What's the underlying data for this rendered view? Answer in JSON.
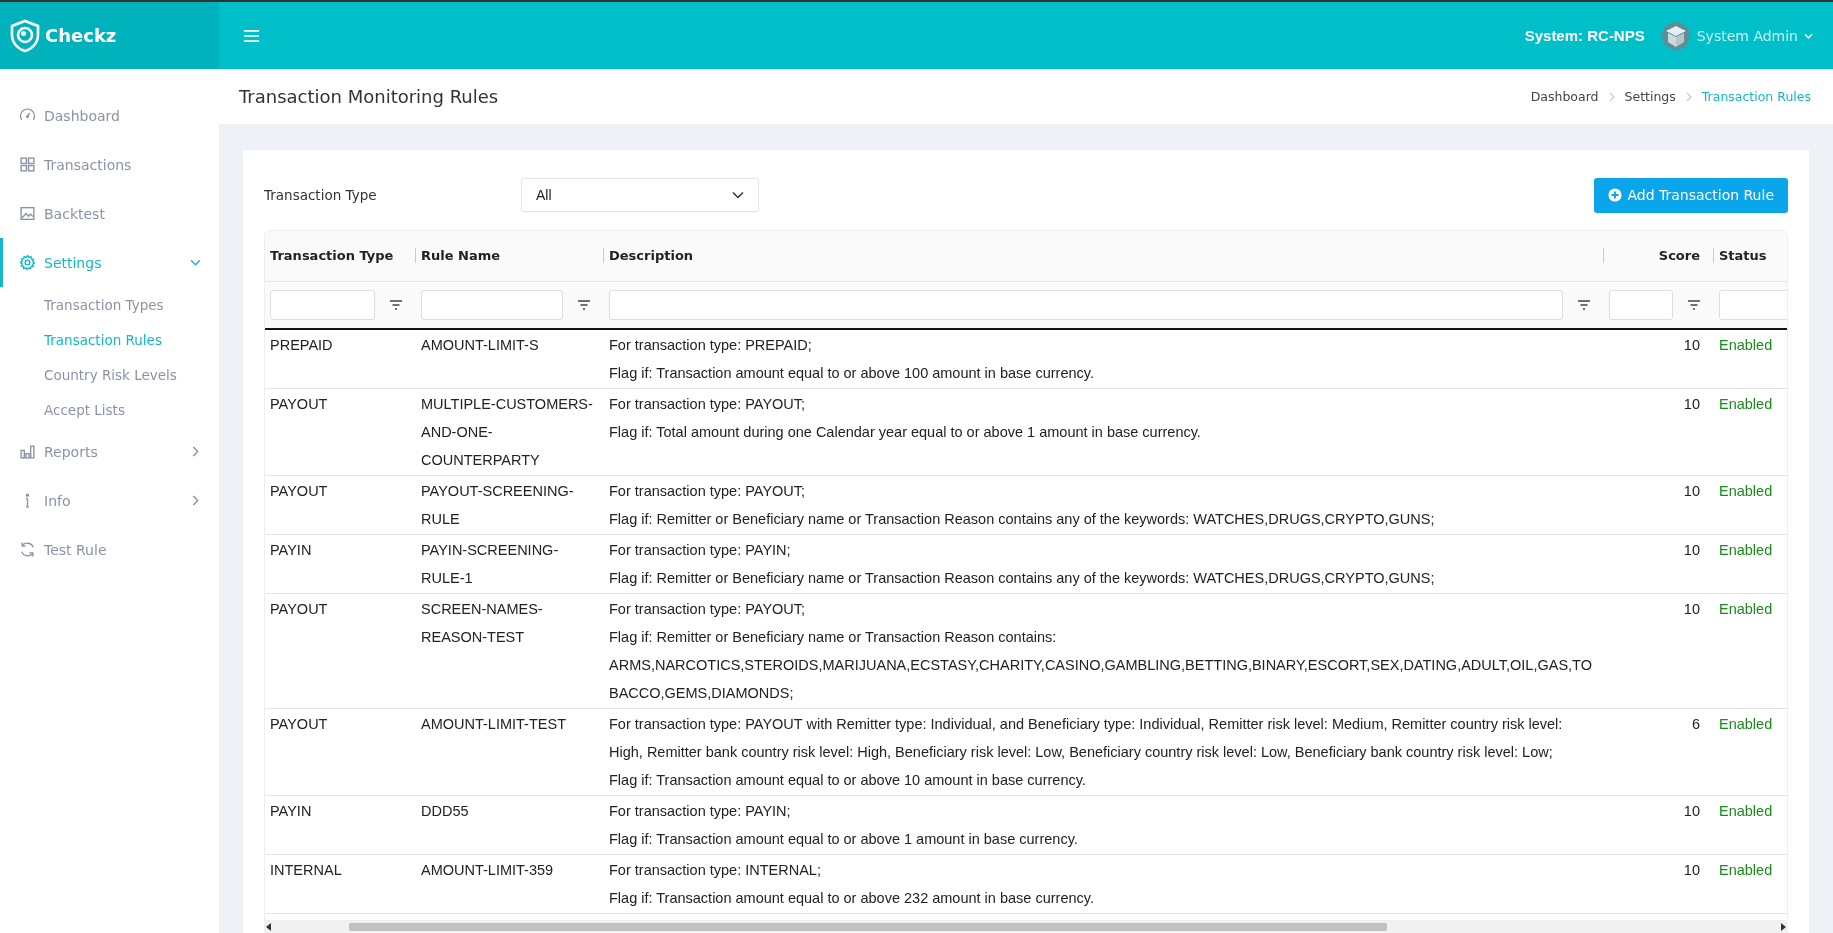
{
  "brand": {
    "name": "Checkz"
  },
  "topbar": {
    "system": "System: RC-NPS",
    "user": "System Admin"
  },
  "sidebar": {
    "items": [
      {
        "label": "Dashboard",
        "kind": "link",
        "selected": false
      },
      {
        "label": "Transactions",
        "kind": "link",
        "selected": false
      },
      {
        "label": "Backtest",
        "kind": "link",
        "selected": false
      },
      {
        "label": "Settings",
        "kind": "group",
        "selected": true,
        "expanded": true,
        "children": [
          {
            "label": "Transaction Types",
            "selected": false
          },
          {
            "label": "Transaction Rules",
            "selected": true
          },
          {
            "label": "Country Risk Levels",
            "selected": false
          },
          {
            "label": "Accept Lists",
            "selected": false
          }
        ]
      },
      {
        "label": "Reports",
        "kind": "group",
        "selected": false,
        "expanded": false
      },
      {
        "label": "Info",
        "kind": "group",
        "selected": false,
        "expanded": false
      },
      {
        "label": "Test Rule",
        "kind": "link",
        "selected": false
      }
    ]
  },
  "page": {
    "title": "Transaction Monitoring Rules",
    "breadcrumb": [
      {
        "label": "Dashboard",
        "current": false
      },
      {
        "label": "Settings",
        "current": false
      },
      {
        "label": "Transaction Rules",
        "current": true
      }
    ]
  },
  "filter": {
    "label": "Transaction Type",
    "value": "All"
  },
  "add_button": "Add Transaction Rule",
  "table": {
    "columns": [
      "Transaction Type",
      "Rule Name",
      "Description",
      "Score",
      "Status"
    ],
    "rows": [
      {
        "type": "PREPAID",
        "rule": "AMOUNT-LIMIT-S",
        "description": [
          "For transaction type: PREPAID;",
          "Flag if: Transaction amount equal to or above 100 amount in base currency."
        ],
        "score": "10",
        "status": {
          "text": "Enabled",
          "kind": "enabled"
        }
      },
      {
        "type": "PAYOUT",
        "rule": "MULTIPLE-CUSTOMERS-AND-ONE-COUNTERPARTY",
        "description": [
          "For transaction type: PAYOUT;",
          "Flag if: Total amount during one Calendar year equal to or above 1 amount in base currency."
        ],
        "score": "10",
        "status": {
          "text": "Enabled",
          "kind": "enabled"
        }
      },
      {
        "type": "PAYOUT",
        "rule": "PAYOUT-SCREENING-RULE",
        "description": [
          "For transaction type: PAYOUT;",
          "Flag if: Remitter or Beneficiary name or Transaction Reason contains any of the keywords: WATCHES,DRUGS,CRYPTO,GUNS;"
        ],
        "score": "10",
        "status": {
          "text": "Enabled",
          "kind": "enabled"
        }
      },
      {
        "type": "PAYIN",
        "rule": "PAYIN-SCREENING-RULE-1",
        "description": [
          "For transaction type: PAYIN;",
          "Flag if: Remitter or Beneficiary name or Transaction Reason contains any of the keywords: WATCHES,DRUGS,CRYPTO,GUNS;"
        ],
        "score": "10",
        "status": {
          "text": "Enabled",
          "kind": "enabled"
        }
      },
      {
        "type": "PAYOUT",
        "rule": "SCREEN-NAMES-REASON-TEST",
        "description": [
          "For transaction type: PAYOUT;",
          "Flag if: Remitter or Beneficiary name or Transaction Reason contains:",
          "ARMS,NARCOTICS,STEROIDS,MARIJUANA,ECSTASY,CHARITY,CASINO,GAMBLING,BETTING,BINARY,ESCORT,SEX,DATING,ADULT,OIL,GAS,TOBACCO,GEMS,DIAMONDS;"
        ],
        "score": "10",
        "status": {
          "text": "Enabled",
          "kind": "enabled"
        }
      },
      {
        "type": "PAYOUT",
        "rule": "AMOUNT-LIMIT-TEST",
        "description": [
          "For transaction type: PAYOUT with Remitter type: Individual, and Beneficiary type: Individual, Remitter risk level: Medium, Remitter country risk level: High, Remitter bank country risk level: High, Beneficiary risk level: Low, Beneficiary country risk level: Low, Beneficiary bank country risk level: Low;",
          "Flag if: Transaction amount equal to or above 10 amount in base currency."
        ],
        "score": "6",
        "status": {
          "text": "Enabled",
          "kind": "enabled"
        }
      },
      {
        "type": "PAYIN",
        "rule": "DDD55",
        "description": [
          "For transaction type: PAYIN;",
          "Flag if: Transaction amount equal to or above 1 amount in base currency."
        ],
        "score": "10",
        "status": {
          "text": "Enabled",
          "kind": "enabled"
        }
      },
      {
        "type": "INTERNAL",
        "rule": "AMOUNT-LIMIT-359",
        "description": [
          "For transaction type: INTERNAL;",
          "Flag if: Transaction amount equal to or above 232 amount in base currency."
        ],
        "score": "10",
        "status": {
          "text": "Enabled",
          "kind": "enabled"
        }
      }
    ]
  }
}
